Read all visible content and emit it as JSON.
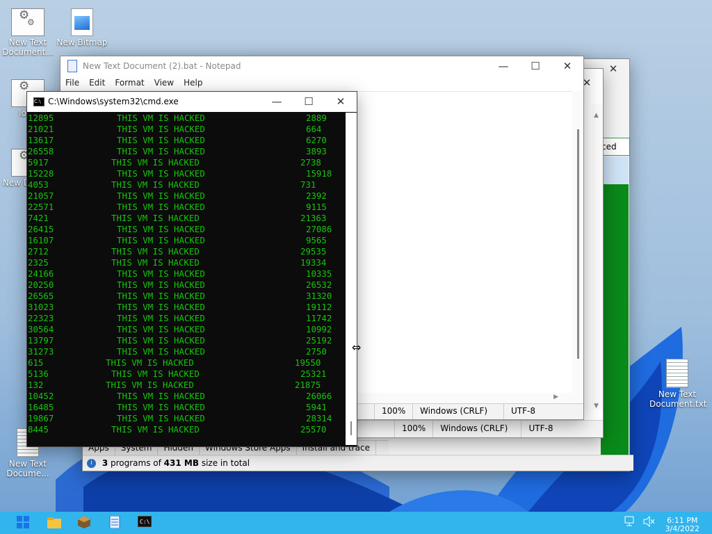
{
  "desktop": {
    "icons": [
      {
        "label": "New Text Document...",
        "type": "settings-file-icon"
      },
      {
        "label": "New Bitmap",
        "type": "bitmap-file-icon"
      },
      {
        "label": "lol...",
        "type": "settings-file-icon"
      },
      {
        "label": "New Docu...",
        "type": "settings-file-icon"
      },
      {
        "label": "New Text Docume...",
        "type": "text-file-icon"
      },
      {
        "label": "New Text Document.txt",
        "type": "text-file-icon"
      }
    ]
  },
  "program_manager": {
    "tabs": [
      "Apps",
      "System",
      "Hidden",
      "Windows Store Apps",
      "Install and trace"
    ],
    "status_prefix": "3",
    "status_mid": " programs of ",
    "status_size": "431 MB",
    "status_suffix": " size in total",
    "selected_text": "ced"
  },
  "notepad_back": {
    "status": {
      "zoom": "100%",
      "line_ending": "Windows (CRLF)",
      "encoding": "UTF-8"
    }
  },
  "notepad": {
    "title": "New Text Document (2).bat - Notepad",
    "menu": [
      "File",
      "Edit",
      "Format",
      "View",
      "Help"
    ],
    "status": {
      "zoom": "100%",
      "line_ending": "Windows (CRLF)",
      "encoding": "UTF-8"
    }
  },
  "cmd": {
    "title": "C:\\Windows\\system32\\cmd.exe",
    "rows": [
      {
        "a": "12895",
        "msg": "THIS VM IS HACKED",
        "b": "2889"
      },
      {
        "a": "21021",
        "msg": "THIS VM IS HACKED",
        "b": "664"
      },
      {
        "a": "13617",
        "msg": "THIS VM IS HACKED",
        "b": "6270"
      },
      {
        "a": "26558",
        "msg": "THIS VM IS HACKED",
        "b": "3893"
      },
      {
        "a": "5917",
        "msg": "THIS VM IS HACKED",
        "b": "2738"
      },
      {
        "a": "15228",
        "msg": "THIS VM IS HACKED",
        "b": "15918"
      },
      {
        "a": "4053",
        "msg": "THIS VM IS HACKED",
        "b": "731"
      },
      {
        "a": "21057",
        "msg": "THIS VM IS HACKED",
        "b": "2392"
      },
      {
        "a": "22571",
        "msg": "THIS VM IS HACKED",
        "b": "9115"
      },
      {
        "a": "7421",
        "msg": "THIS VM IS HACKED",
        "b": "21363"
      },
      {
        "a": "26415",
        "msg": "THIS VM IS HACKED",
        "b": "27086"
      },
      {
        "a": "16107",
        "msg": "THIS VM IS HACKED",
        "b": "9565"
      },
      {
        "a": "2712",
        "msg": "THIS VM IS HACKED",
        "b": "29535"
      },
      {
        "a": "2325",
        "msg": "THIS VM IS HACKED",
        "b": "19334"
      },
      {
        "a": "24166",
        "msg": "THIS VM IS HACKED",
        "b": "10335"
      },
      {
        "a": "20250",
        "msg": "THIS VM IS HACKED",
        "b": "26532"
      },
      {
        "a": "26565",
        "msg": "THIS VM IS HACKED",
        "b": "31320"
      },
      {
        "a": "31023",
        "msg": "THIS VM IS HACKED",
        "b": "19112"
      },
      {
        "a": "22323",
        "msg": "THIS VM IS HACKED",
        "b": "11742"
      },
      {
        "a": "30564",
        "msg": "THIS VM IS HACKED",
        "b": "10992"
      },
      {
        "a": "13797",
        "msg": "THIS VM IS HACKED",
        "b": "25192"
      },
      {
        "a": "31273",
        "msg": "THIS VM IS HACKED",
        "b": "2750"
      },
      {
        "a": "615",
        "msg": "THIS VM IS HACKED",
        "b": "19550"
      },
      {
        "a": "5136",
        "msg": "THIS VM IS HACKED",
        "b": "25321"
      },
      {
        "a": "132",
        "msg": "THIS VM IS HACKED",
        "b": "21875"
      },
      {
        "a": "10452",
        "msg": "THIS VM IS HACKED",
        "b": "26066"
      },
      {
        "a": "16485",
        "msg": "THIS VM IS HACKED",
        "b": "5941"
      },
      {
        "a": "19867",
        "msg": "THIS VM IS HACKED",
        "b": "28314"
      },
      {
        "a": "8445",
        "msg": "THIS VM IS HACKED",
        "b": "25570"
      }
    ]
  },
  "taskbar": {
    "items": [
      "start-icon",
      "file-explorer-icon",
      "package-icon",
      "app-icon",
      "terminal-icon"
    ],
    "time": "6:11 PM",
    "date": "3/4/2022"
  },
  "colors": {
    "console_text": "#16c60c",
    "taskbar": "#32b4ec",
    "accent_green": "#0a8a1a"
  }
}
